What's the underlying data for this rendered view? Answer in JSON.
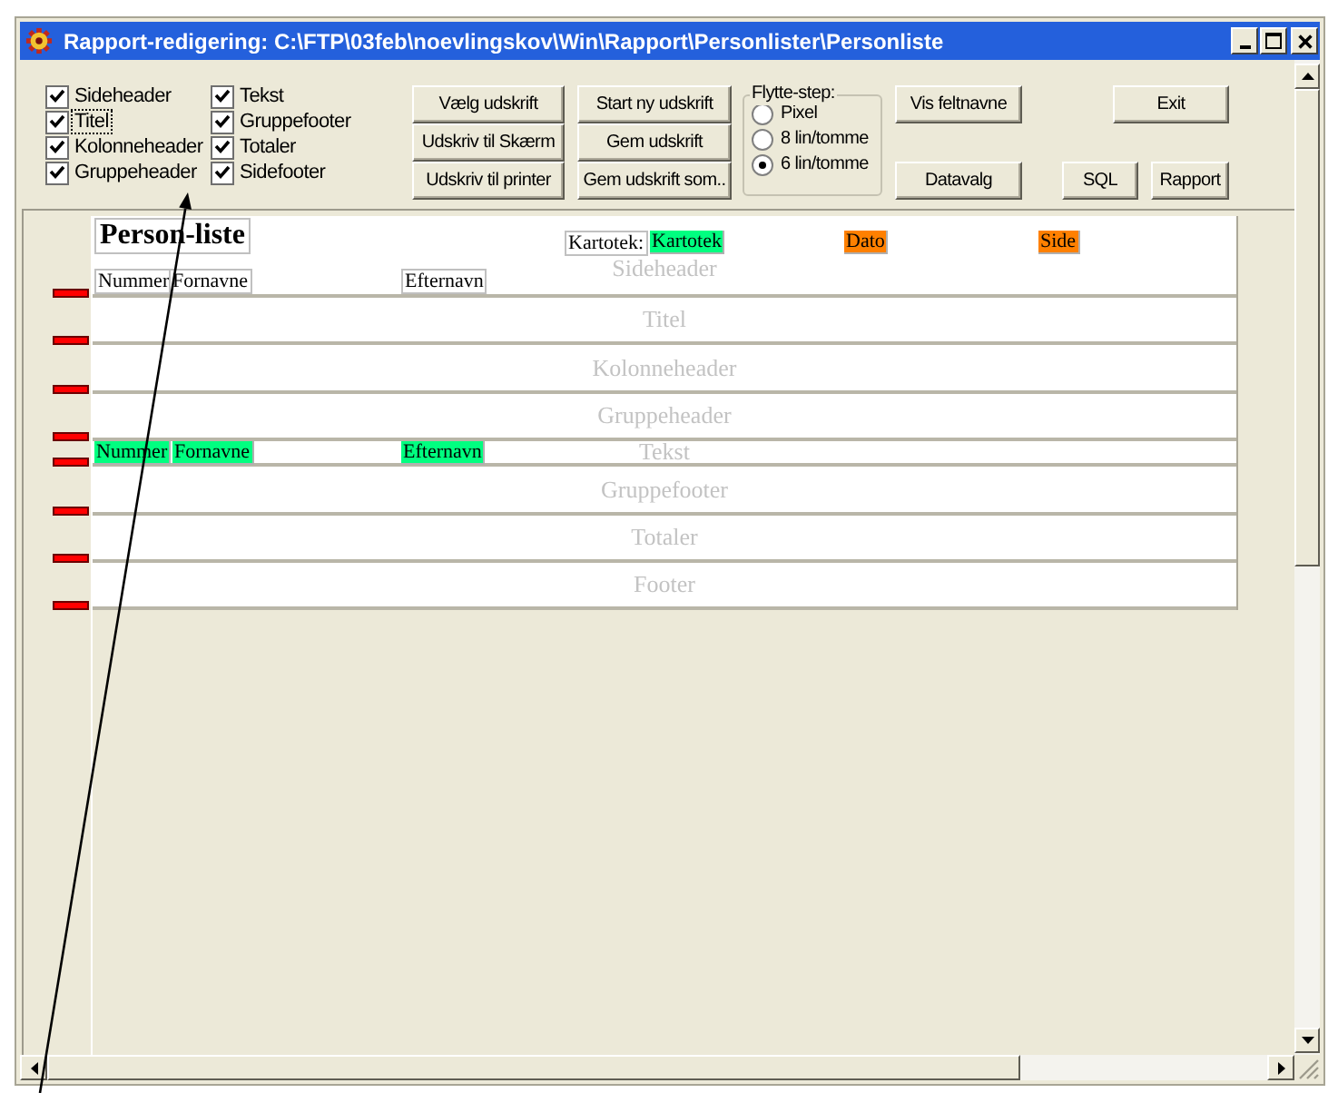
{
  "window": {
    "title": "Rapport-redigering: C:\\FTP\\03feb\\noevlingskov\\Win\\Rapport\\Personlister\\Personliste"
  },
  "section_toggles": [
    {
      "label": "Sideheader",
      "checked": true,
      "focused": false
    },
    {
      "label": "Titel",
      "checked": true,
      "focused": true
    },
    {
      "label": "Kolonneheader",
      "checked": true,
      "focused": false
    },
    {
      "label": "Gruppeheader",
      "checked": true,
      "focused": false
    },
    {
      "label": "Tekst",
      "checked": true,
      "focused": false
    },
    {
      "label": "Gruppefooter",
      "checked": true,
      "focused": false
    },
    {
      "label": "Totaler",
      "checked": true,
      "focused": false
    },
    {
      "label": "Sidefooter",
      "checked": true,
      "focused": false
    }
  ],
  "print_buttons": [
    "Vælg udskrift",
    "Udskriv til Skærm",
    "Udskriv til printer"
  ],
  "save_buttons": [
    "Start ny udskrift",
    "Gem udskrift",
    "Gem udskrift som.."
  ],
  "move_step": {
    "title": "Flytte-step:",
    "options": [
      {
        "label": "Pixel",
        "selected": false
      },
      {
        "label": "8 lin/tomme",
        "selected": false
      },
      {
        "label": "6 lin/tomme",
        "selected": true
      }
    ]
  },
  "field_buttons": [
    "Vis feltnavne",
    "Datavalg"
  ],
  "exit_button": "Exit",
  "query_buttons": [
    "SQL",
    "Rapport"
  ],
  "report": {
    "bands": [
      {
        "name": "Sideheader",
        "fields": [
          {
            "text": "Person-liste",
            "kind": "title"
          },
          {
            "text": "Kartotek:",
            "kind": "label"
          },
          {
            "text": "Kartotek",
            "kind": "field",
            "color": "#00ff80"
          },
          {
            "text": "Dato",
            "kind": "field",
            "color": "#ff8000"
          },
          {
            "text": "Side",
            "kind": "field",
            "color": "#ff8000"
          },
          {
            "text": "Nummer",
            "kind": "label"
          },
          {
            "text": "Fornavne",
            "kind": "label"
          },
          {
            "text": "Efternavn",
            "kind": "label"
          }
        ]
      },
      {
        "name": "Titel"
      },
      {
        "name": "Kolonneheader"
      },
      {
        "name": "Gruppeheader"
      },
      {
        "name": "Tekst",
        "fields": [
          {
            "text": "Nummer",
            "kind": "field",
            "color": "#00ff80"
          },
          {
            "text": "Fornavne",
            "kind": "field",
            "color": "#00ff80"
          },
          {
            "text": "Efternavn",
            "kind": "field",
            "color": "#00ff80"
          }
        ]
      },
      {
        "name": "Gruppefooter"
      },
      {
        "name": "Totaler"
      },
      {
        "name": "Footer"
      }
    ]
  }
}
